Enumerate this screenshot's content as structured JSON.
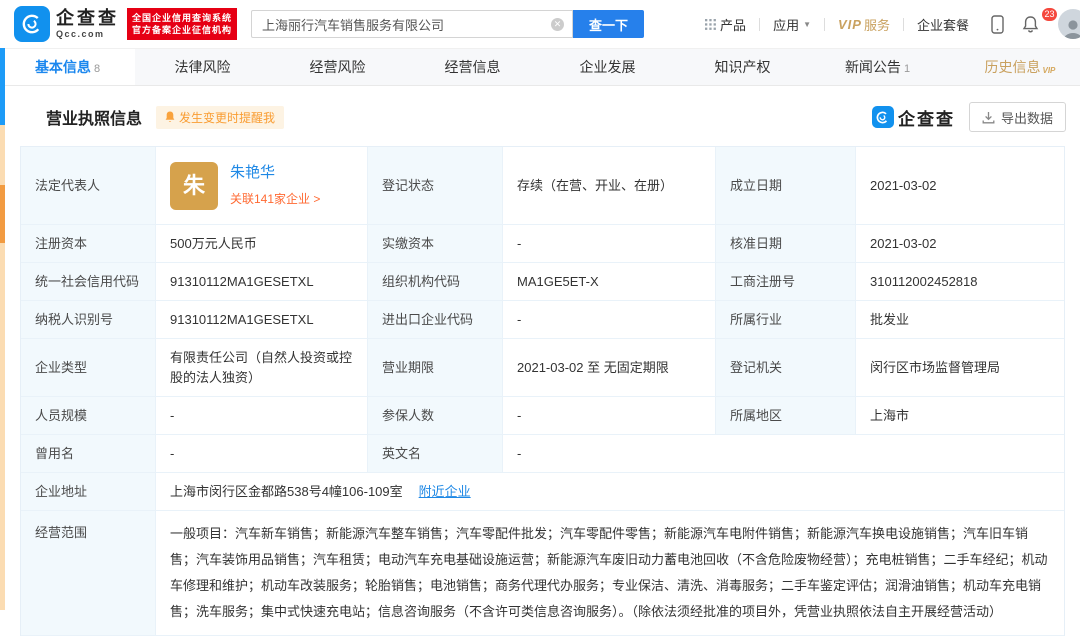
{
  "topbar": {
    "logo_name": "企查查",
    "logo_domain": "Qcc.com",
    "cert_line1": "全国企业信用查询系统",
    "cert_line2": "官方备案企业征信机构",
    "search_value": "上海丽行汽车销售服务有限公司",
    "search_button": "查一下",
    "menu_product": "产品",
    "menu_app": "应用",
    "menu_vip": "VIP",
    "menu_vip_suffix": "服务",
    "menu_package": "企业套餐",
    "notification_count": "23"
  },
  "tabs": [
    {
      "label": "基本信息",
      "count": "8"
    },
    {
      "label": "法律风险",
      "count": ""
    },
    {
      "label": "经营风险",
      "count": ""
    },
    {
      "label": "经营信息",
      "count": ""
    },
    {
      "label": "企业发展",
      "count": ""
    },
    {
      "label": "知识产权",
      "count": ""
    },
    {
      "label": "新闻公告",
      "count": "1"
    },
    {
      "label": "历史信息",
      "vip": "VIP"
    }
  ],
  "section": {
    "title": "营业执照信息",
    "alert_badge": "发生变更时提醒我",
    "brand": "企查查",
    "export_button": "导出数据"
  },
  "table": {
    "legal_rep": {
      "label": "法定代表人",
      "avatar_char": "朱",
      "name": "朱艳华",
      "related": "关联141家企业 >"
    },
    "reg_status": {
      "label": "登记状态",
      "value": "存续（在营、开业、在册）"
    },
    "establish_date": {
      "label": "成立日期",
      "value": "2021-03-02"
    },
    "reg_capital": {
      "label": "注册资本",
      "value": "500万元人民币"
    },
    "paid_capital": {
      "label": "实缴资本",
      "value": "-"
    },
    "approval_date": {
      "label": "核准日期",
      "value": "2021-03-02"
    },
    "credit_code": {
      "label": "统一社会信用代码",
      "value": "91310112MA1GESETXL"
    },
    "org_code": {
      "label": "组织机构代码",
      "value": "MA1GE5ET-X"
    },
    "reg_number": {
      "label": "工商注册号",
      "value": "310112002452818"
    },
    "taxpayer_id": {
      "label": "纳税人识别号",
      "value": "91310112MA1GESETXL"
    },
    "import_export_code": {
      "label": "进出口企业代码",
      "value": "-"
    },
    "industry": {
      "label": "所属行业",
      "value": "批发业"
    },
    "company_type": {
      "label": "企业类型",
      "value": "有限责任公司（自然人投资或控股的法人独资）"
    },
    "business_term": {
      "label": "营业期限",
      "value": "2021-03-02 至 无固定期限"
    },
    "reg_authority": {
      "label": "登记机关",
      "value": "闵行区市场监督管理局"
    },
    "staff_size": {
      "label": "人员规模",
      "value": "-"
    },
    "insured_count": {
      "label": "参保人数",
      "value": "-"
    },
    "region": {
      "label": "所属地区",
      "value": "上海市"
    },
    "former_name": {
      "label": "曾用名",
      "value": "-"
    },
    "english_name": {
      "label": "英文名",
      "value": "-"
    },
    "address": {
      "label": "企业地址",
      "value": "上海市闵行区金都路538号4幢106-109室",
      "link": "附近企业"
    },
    "business_scope": {
      "label": "经营范围",
      "value": "一般项目：汽车新车销售；新能源汽车整车销售；汽车零配件批发；汽车零配件零售；新能源汽车电附件销售；新能源汽车换电设施销售；汽车旧车销售；汽车装饰用品销售；汽车租赁；电动汽车充电基础设施运营；新能源汽车废旧动力蓄电池回收（不含危险废物经营）；充电桩销售；二手车经纪；机动车修理和维护；机动车改装服务；轮胎销售；电池销售；商务代理代办服务；专业保洁、清洗、消毒服务；二手车鉴定评估；润滑油销售；机动车充电销售；洗车服务；集中式快速充电站；信息咨询服务（不含许可类信息咨询服务）。（除依法须经批准的项目外，凭营业执照依法自主开展经营活动）"
    }
  }
}
